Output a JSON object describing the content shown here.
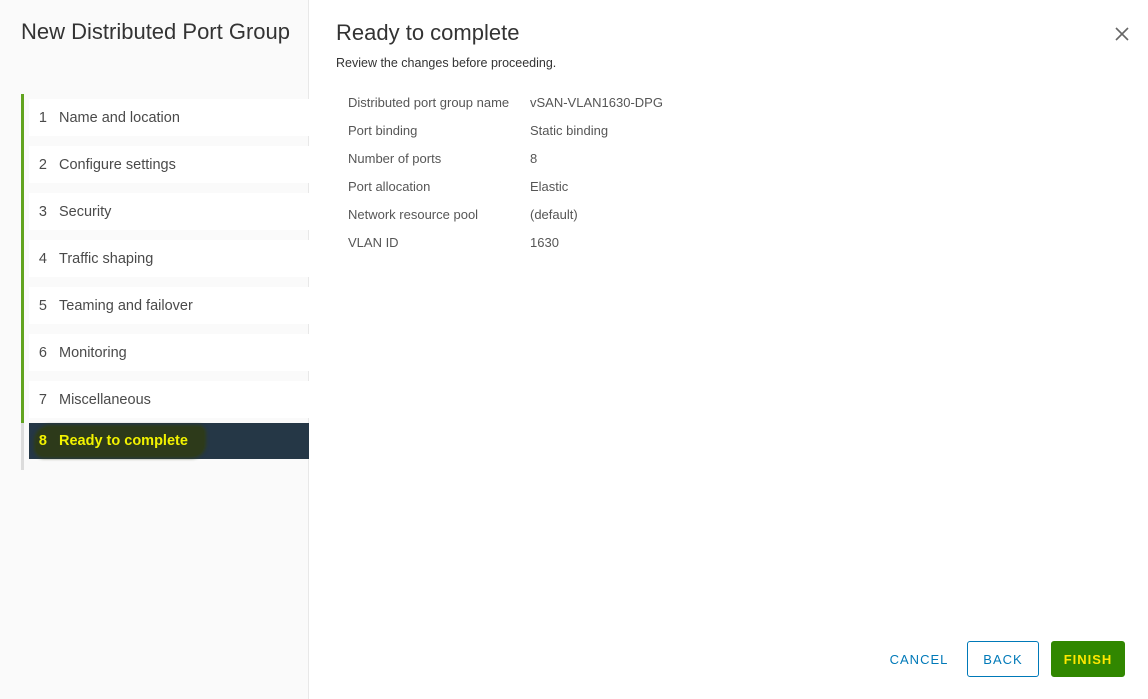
{
  "wizard": {
    "title": "New Distributed Port Group",
    "steps": [
      {
        "num": "1",
        "label": "Name and location"
      },
      {
        "num": "2",
        "label": "Configure settings"
      },
      {
        "num": "3",
        "label": "Security"
      },
      {
        "num": "4",
        "label": "Traffic shaping"
      },
      {
        "num": "5",
        "label": "Teaming and failover"
      },
      {
        "num": "6",
        "label": "Monitoring"
      },
      {
        "num": "7",
        "label": "Miscellaneous"
      },
      {
        "num": "8",
        "label": "Ready to complete"
      }
    ],
    "active_step": 8
  },
  "page": {
    "title": "Ready to complete",
    "subtitle": "Review the changes before proceeding."
  },
  "summary": [
    {
      "key": "Distributed port group name",
      "value": "vSAN-VLAN1630-DPG"
    },
    {
      "key": "Port binding",
      "value": "Static binding"
    },
    {
      "key": "Number of ports",
      "value": "8"
    },
    {
      "key": "Port allocation",
      "value": "Elastic"
    },
    {
      "key": "Network resource pool",
      "value": "(default)"
    },
    {
      "key": "VLAN ID",
      "value": "1630"
    }
  ],
  "buttons": {
    "cancel": "CANCEL",
    "back": "BACK",
    "finish": "FINISH"
  },
  "icons": {
    "close": "close-icon"
  },
  "colors": {
    "step_accent": "#62a420",
    "active_step_bg": "#253746",
    "active_step_text": "#f2f200",
    "primary_blue": "#0079b8",
    "finish_bg": "#318700",
    "finish_text": "#ffe800"
  }
}
